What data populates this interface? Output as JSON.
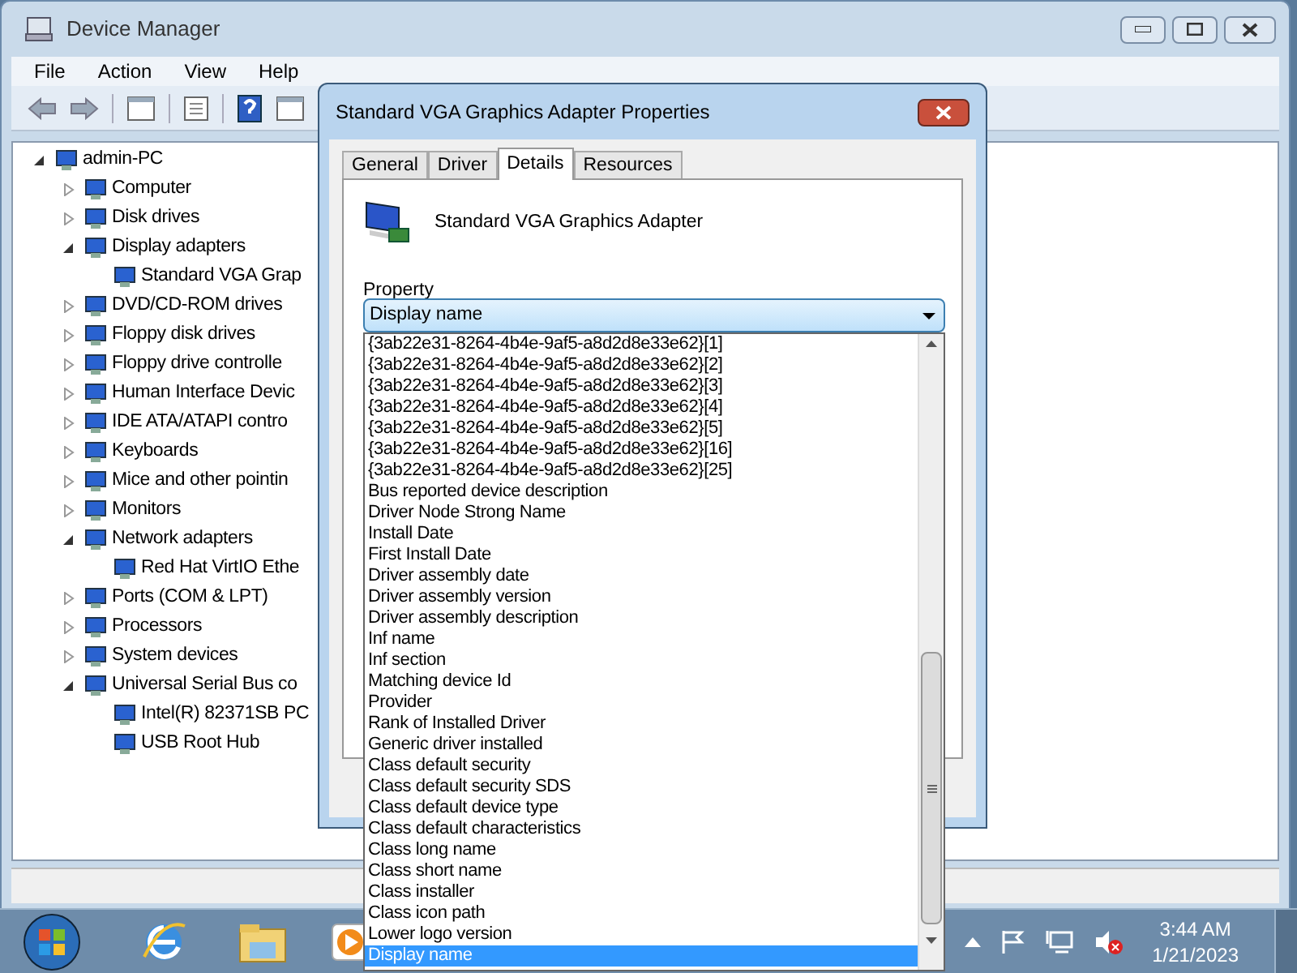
{
  "window": {
    "title": "Device Manager"
  },
  "menu": [
    "File",
    "Action",
    "View",
    "Help"
  ],
  "tree": {
    "label": "admin-PC",
    "expanded": true,
    "children": [
      {
        "label": "Computer",
        "expanded": false
      },
      {
        "label": "Disk drives",
        "expanded": false
      },
      {
        "label": "Display adapters",
        "expanded": true,
        "children": [
          {
            "label": "Standard VGA Grap"
          }
        ]
      },
      {
        "label": "DVD/CD-ROM drives",
        "expanded": false
      },
      {
        "label": "Floppy disk drives",
        "expanded": false
      },
      {
        "label": "Floppy drive controlle",
        "expanded": false
      },
      {
        "label": "Human Interface Devic",
        "expanded": false
      },
      {
        "label": "IDE ATA/ATAPI contro",
        "expanded": false
      },
      {
        "label": "Keyboards",
        "expanded": false
      },
      {
        "label": "Mice and other pointin",
        "expanded": false
      },
      {
        "label": "Monitors",
        "expanded": false
      },
      {
        "label": "Network adapters",
        "expanded": true,
        "children": [
          {
            "label": "Red Hat VirtIO Ethe"
          }
        ]
      },
      {
        "label": "Ports (COM & LPT)",
        "expanded": false
      },
      {
        "label": "Processors",
        "expanded": false
      },
      {
        "label": "System devices",
        "expanded": false
      },
      {
        "label": "Universal Serial Bus co",
        "expanded": true,
        "children": [
          {
            "label": "Intel(R) 82371SB PC"
          },
          {
            "label": "USB Root Hub"
          }
        ]
      }
    ]
  },
  "dialog": {
    "title": "Standard VGA Graphics Adapter Properties",
    "tabs": [
      {
        "label": "General",
        "selected": false
      },
      {
        "label": "Driver",
        "selected": false
      },
      {
        "label": "Details",
        "selected": true
      },
      {
        "label": "Resources",
        "selected": false
      }
    ],
    "device_name": "Standard VGA Graphics Adapter",
    "property_label": "Property",
    "property_value": "Display name",
    "options": [
      {
        "label": "{3ab22e31-8264-4b4e-9af5-a8d2d8e33e62}[1]",
        "selected": false
      },
      {
        "label": "{3ab22e31-8264-4b4e-9af5-a8d2d8e33e62}[2]",
        "selected": false
      },
      {
        "label": "{3ab22e31-8264-4b4e-9af5-a8d2d8e33e62}[3]",
        "selected": false
      },
      {
        "label": "{3ab22e31-8264-4b4e-9af5-a8d2d8e33e62}[4]",
        "selected": false
      },
      {
        "label": "{3ab22e31-8264-4b4e-9af5-a8d2d8e33e62}[5]",
        "selected": false
      },
      {
        "label": "{3ab22e31-8264-4b4e-9af5-a8d2d8e33e62}[16]",
        "selected": false
      },
      {
        "label": "{3ab22e31-8264-4b4e-9af5-a8d2d8e33e62}[25]",
        "selected": false
      },
      {
        "label": "Bus reported device description",
        "selected": false
      },
      {
        "label": "Driver Node Strong Name",
        "selected": false
      },
      {
        "label": "Install Date",
        "selected": false
      },
      {
        "label": "First Install Date",
        "selected": false
      },
      {
        "label": "Driver assembly date",
        "selected": false
      },
      {
        "label": "Driver assembly version",
        "selected": false
      },
      {
        "label": "Driver assembly description",
        "selected": false
      },
      {
        "label": "Inf name",
        "selected": false
      },
      {
        "label": "Inf section",
        "selected": false
      },
      {
        "label": "Matching device Id",
        "selected": false
      },
      {
        "label": "Provider",
        "selected": false
      },
      {
        "label": "Rank of Installed Driver",
        "selected": false
      },
      {
        "label": "Generic driver installed",
        "selected": false
      },
      {
        "label": "Class default security",
        "selected": false
      },
      {
        "label": "Class default security SDS",
        "selected": false
      },
      {
        "label": "Class default device type",
        "selected": false
      },
      {
        "label": "Class default characteristics",
        "selected": false
      },
      {
        "label": "Class long name",
        "selected": false
      },
      {
        "label": "Class short name",
        "selected": false
      },
      {
        "label": "Class installer",
        "selected": false
      },
      {
        "label": "Class icon path",
        "selected": false
      },
      {
        "label": "Lower logo version",
        "selected": false
      },
      {
        "label": "Display name",
        "selected": true
      }
    ]
  },
  "taskbar": {
    "time": "3:44 AM",
    "date": "1/21/2023"
  }
}
